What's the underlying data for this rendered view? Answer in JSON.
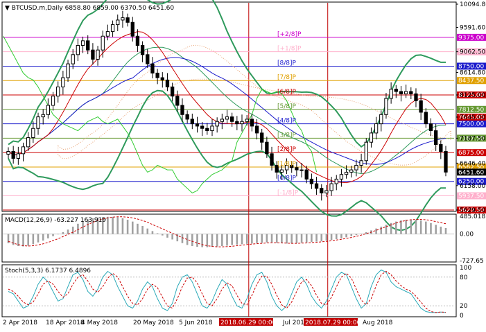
{
  "window": {
    "title": "BTCUSD.m,Daily",
    "ohlc": "6858.80 6859.00 6370.50 6451.60"
  },
  "colors": {
    "background": "#ffffff",
    "frame": "#000000",
    "candle": "#000000",
    "bollinger": "#2e9a5c",
    "ichimoku_cloud": "#e8a070",
    "kijun": "#1a1acc",
    "tenkan": "#cc0000",
    "chikou": "#33cc33",
    "vline": "#c00000",
    "macd_hist": "#a0a0a0",
    "macd_signal": "#cc0000",
    "stoch_main": "#2aa9b8",
    "stoch_signal": "#cc0000"
  },
  "chart_data": [
    {
      "type": "candlestick",
      "title": "BTCUSD.m,Daily",
      "ylim": [
        5629.5,
        10094.8
      ],
      "y_ticks": [
        "10094.80",
        "9591.60",
        "9062.50",
        "8614.80",
        "8125.00",
        "7645.00",
        "7187.50",
        "6646.40",
        "6158.00",
        "5629.50"
      ],
      "x_ticks": [
        "2 Apr 2018",
        "18 Apr 2018",
        "4 May 2018",
        "20 May 2018",
        "5 Jun 2018",
        "2018.06.29 00:00",
        "Jul 2018",
        "2018.07.29 00:00",
        "Aug 2018"
      ],
      "close_series": [
        6900,
        6750,
        6850,
        7000,
        7200,
        7400,
        7650,
        7700,
        7900,
        8100,
        8300,
        8500,
        8800,
        9000,
        9200,
        9300,
        9100,
        8900,
        9100,
        9400,
        9500,
        9650,
        9750,
        9800,
        9700,
        9400,
        9200,
        9000,
        8800,
        8600,
        8500,
        8450,
        8300,
        8100,
        7900,
        7700,
        7600,
        7500,
        7450,
        7400,
        7350,
        7450,
        7550,
        7600,
        7650,
        7550,
        7500,
        7550,
        7600,
        7450,
        7300,
        7100,
        6850,
        6600,
        6450,
        6500,
        6600,
        6550,
        6500,
        6500,
        6300,
        6200,
        6100,
        6000,
        6050,
        6200,
        6300,
        6400,
        6450,
        6500,
        6600,
        6700,
        7100,
        7300,
        7500,
        7700,
        8050,
        8250,
        8200,
        8150,
        8200,
        8150,
        8000,
        7750,
        7500,
        7350,
        7050,
        6900,
        6451.6
      ],
      "murrey_levels": [
        {
          "label": "[+2/8]P",
          "value": 9375.0,
          "price": "9375.00",
          "color": "#cc00cc"
        },
        {
          "label": "[+1/8]P",
          "value": 9062.5,
          "price": "9062.50",
          "color": "#ffb0cc"
        },
        {
          "label": "[8/8]P",
          "value": 8750.0,
          "price": "8750.00",
          "color": "#1a1acc"
        },
        {
          "label": "[7/8]P",
          "value": 8437.5,
          "price": "8437.50",
          "color": "#e0a000"
        },
        {
          "label": "[6/8]P",
          "value": 8125.0,
          "price": "8125.00",
          "color": "#cc0000"
        },
        {
          "label": "[5/8]P",
          "value": 7812.5,
          "price": "7812.50",
          "color": "#669933"
        },
        {
          "label": "[4/8]P",
          "value": 7500.0,
          "price": "7500.00",
          "color": "#1a1acc"
        },
        {
          "label": "[3/8]P",
          "value": 7187.5,
          "price": "7187.50",
          "color": "#669933"
        },
        {
          "label": "[2/8]P",
          "value": 6875.0,
          "price": "6875.00",
          "color": "#cc0000"
        },
        {
          "label": "[1/8]P",
          "value": 6562.5,
          "price": "6562.50",
          "color": "#e0a000"
        },
        {
          "label": "[0/8]P",
          "value": 6250.0,
          "price": "6250.00",
          "color": "#1a1acc"
        },
        {
          "label": "[-1/8]P",
          "value": 5937.5,
          "price": "5937.50",
          "color": "#ffb0cc"
        },
        {
          "label": "",
          "value": 5629.5,
          "price": "5629.50",
          "color": "#cc0000"
        }
      ],
      "extra_price_labels": [
        {
          "value": 7645.0,
          "price": "7645.00",
          "color": "#cc0000"
        },
        {
          "value": 6451.6,
          "price": "6451.60",
          "color": "#000000"
        }
      ]
    },
    {
      "type": "bar",
      "title": "MACD(12,26,9) -63.227 163.919",
      "ylim": [
        -727.65,
        485.018
      ],
      "y_ticks": [
        "485.018",
        "0.00",
        "-727.65"
      ],
      "histogram": [
        -250,
        -300,
        -330,
        -340,
        -320,
        -280,
        -230,
        -180,
        -120,
        -60,
        -10,
        50,
        120,
        200,
        280,
        350,
        400,
        430,
        450,
        460,
        470,
        470,
        460,
        430,
        390,
        340,
        280,
        220,
        150,
        80,
        20,
        -40,
        -100,
        -150,
        -200,
        -250,
        -300,
        -330,
        -350,
        -360,
        -360,
        -350,
        -340,
        -330,
        -320,
        -300,
        -290,
        -280,
        -270,
        -260,
        -250,
        -240,
        -230,
        -230,
        -240,
        -250,
        -260,
        -260,
        -250,
        -240,
        -230,
        -220,
        -210,
        -200,
        -180,
        -160,
        -140,
        -120,
        -90,
        -60,
        -30,
        10,
        50,
        100,
        150,
        200,
        250,
        300,
        340,
        370,
        390,
        400,
        390,
        370,
        340,
        300,
        250,
        200,
        163.919
      ],
      "signal": [
        -200,
        -250,
        -290,
        -320,
        -330,
        -320,
        -300,
        -270,
        -230,
        -180,
        -130,
        -70,
        -10,
        50,
        120,
        190,
        260,
        320,
        370,
        410,
        440,
        460,
        470,
        470,
        460,
        440,
        410,
        370,
        320,
        260,
        200,
        140,
        80,
        20,
        -40,
        -100,
        -150,
        -200,
        -250,
        -290,
        -320,
        -340,
        -350,
        -350,
        -345,
        -335,
        -320,
        -305,
        -290,
        -275,
        -265,
        -255,
        -245,
        -240,
        -240,
        -245,
        -250,
        -255,
        -255,
        -250,
        -245,
        -235,
        -225,
        -215,
        -200,
        -185,
        -165,
        -145,
        -120,
        -95,
        -65,
        -30,
        10,
        50,
        100,
        150,
        200,
        250,
        300,
        340,
        370,
        390,
        400,
        400,
        390,
        370,
        340,
        310,
        280
      ]
    },
    {
      "type": "line",
      "title": "Stoch(5,3,3) 6.1737 6.4896",
      "ylim": [
        0,
        100
      ],
      "y_ticks": [
        "100",
        "80",
        "20",
        "0"
      ],
      "series": [
        {
          "values": [
            50,
            45,
            30,
            15,
            20,
            40,
            65,
            80,
            70,
            50,
            30,
            35,
            60,
            85,
            90,
            75,
            50,
            40,
            55,
            80,
            92,
            85,
            60,
            40,
            20,
            15,
            30,
            55,
            70,
            60,
            35,
            15,
            10,
            25,
            60,
            80,
            85,
            70,
            45,
            20,
            15,
            30,
            55,
            75,
            65,
            40,
            20,
            15,
            35,
            65,
            85,
            90,
            70,
            40,
            20,
            10,
            20,
            45,
            70,
            80,
            65,
            40,
            25,
            15,
            30,
            55,
            80,
            90,
            85,
            60,
            35,
            15,
            25,
            60,
            85,
            95,
            90,
            70,
            60,
            55,
            50,
            45,
            30,
            15,
            8,
            6,
            6,
            7,
            6.1737
          ]
        },
        {
          "values": [
            55,
            50,
            40,
            28,
            22,
            28,
            45,
            65,
            72,
            65,
            50,
            38,
            45,
            65,
            80,
            85,
            72,
            55,
            48,
            60,
            78,
            88,
            80,
            60,
            40,
            25,
            22,
            35,
            55,
            65,
            58,
            38,
            20,
            15,
            35,
            60,
            78,
            80,
            68,
            45,
            25,
            20,
            35,
            55,
            68,
            62,
            42,
            25,
            22,
            42,
            65,
            82,
            82,
            65,
            42,
            22,
            15,
            28,
            50,
            70,
            75,
            62,
            42,
            25,
            22,
            38,
            60,
            80,
            88,
            78,
            55,
            32,
            22,
            35,
            62,
            85,
            92,
            85,
            72,
            62,
            55,
            50,
            40,
            28,
            15,
            8,
            6,
            7,
            6.4896
          ]
        }
      ]
    }
  ]
}
